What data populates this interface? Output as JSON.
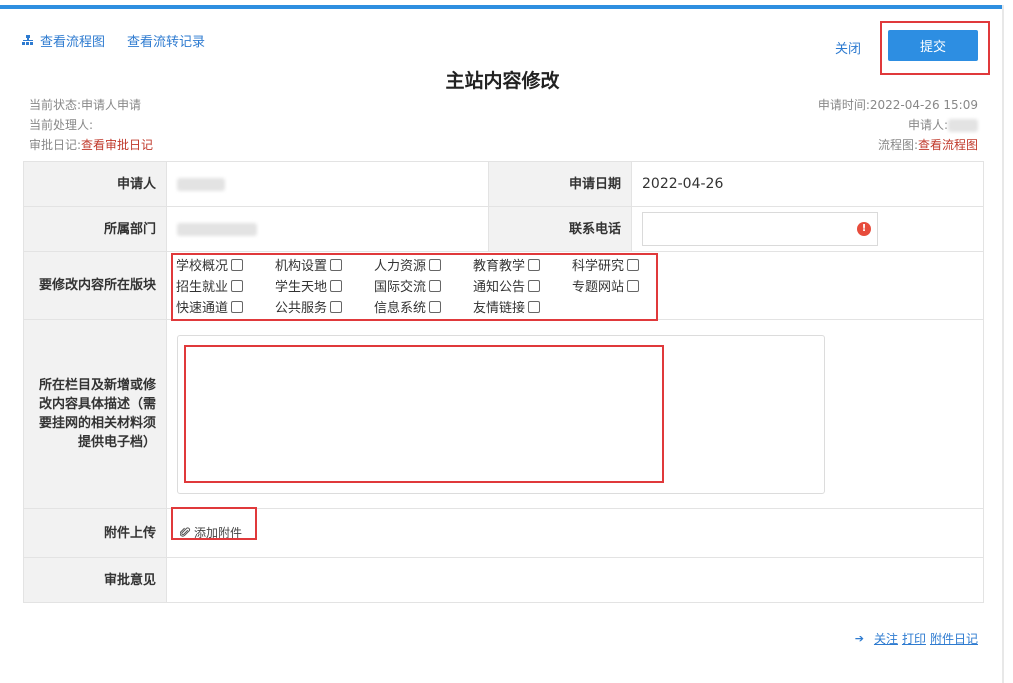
{
  "header": {
    "view_flowchart": "查看流程图",
    "view_transfer_log": "查看流转记录",
    "close": "关闭",
    "submit": "提交"
  },
  "title": "主站内容修改",
  "meta_left": {
    "status": "当前状态:申请人申请",
    "handler": "当前处理人:",
    "approval_log_label": "审批日记:",
    "approval_log_link": "查看审批日记"
  },
  "meta_right": {
    "apply_time": "申请时间:2022-04-26 15:09",
    "applicant": "申请人:",
    "flowchart_label": "流程图:",
    "flowchart_link": "查看流程图"
  },
  "form": {
    "applicant_label": "申请人",
    "apply_date_label": "申请日期",
    "apply_date_value": "2022-04-26",
    "department_label": "所属部门",
    "phone_label": "联系电话",
    "section_label": "要修改内容所在版块",
    "sections": [
      "学校概况",
      "机构设置",
      "人力资源",
      "教育教学",
      "科学研究",
      "招生就业",
      "学生天地",
      "国际交流",
      "通知公告",
      "专题网站",
      "快速通道",
      "公共服务",
      "信息系统",
      "友情链接"
    ],
    "description_label": "所在栏目及新增或修改内容具体描述（需要挂网的相关材料须提供电子档）",
    "attachment_label": "附件上传",
    "add_attachment": "添加附件",
    "approval_label": "审批意见"
  },
  "footer": {
    "follow": "关注",
    "print": "打印",
    "attachment_log": "附件日记"
  },
  "colors": {
    "accent": "#2e8fe0",
    "link": "#2e7bd0",
    "highlight": "#e0393b",
    "red_link": "#c0392b"
  }
}
